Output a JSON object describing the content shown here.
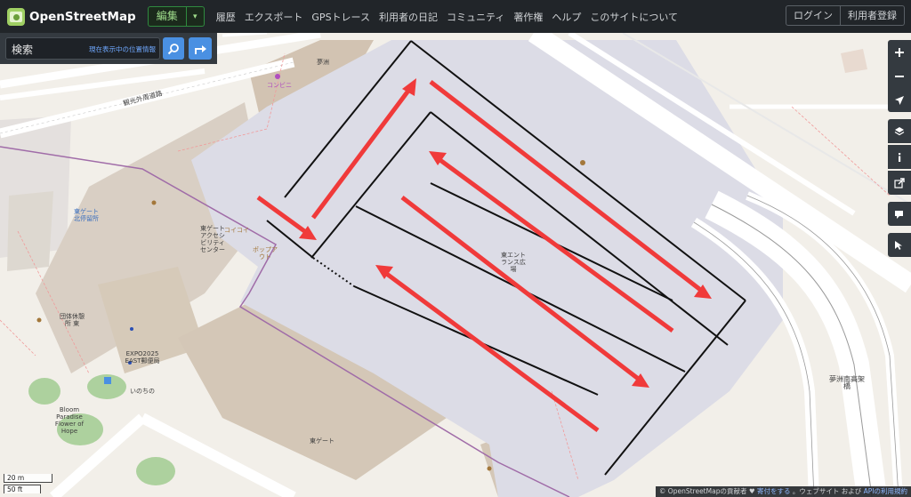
{
  "header": {
    "site_name": "OpenStreetMap",
    "edit_label": "編集",
    "nav": [
      "履歴",
      "エクスポート",
      "GPSトレース",
      "利用者の日記",
      "コミュニティ",
      "著作権",
      "ヘルプ",
      "このサイトについて"
    ],
    "login": "ログイン",
    "signup": "利用者登録"
  },
  "search": {
    "placeholder": "検索",
    "where_label": "現在表示中の位置情報"
  },
  "map_labels": {
    "road": "観光外周道路",
    "plaza": "東エントランス広場",
    "gate_station": "東ゲート北停留所",
    "info_center": "東ゲートアクセシビリティセンター",
    "coicoi": "コイコイ",
    "post": "ポップアウト",
    "rest": "団体休憩所 東",
    "expo_post": "EXPO2025 EAST郵便局",
    "inochi": "いのちの",
    "bloom": "Bloom Paradise Flower of Hope",
    "east_gate": "東ゲート",
    "bridge": "夢洲南高架橋",
    "top": "夢洲",
    "top2": "コンビニ"
  },
  "scale": {
    "metric": "20 m",
    "imperial": "50 ft"
  },
  "attribution": {
    "text1": "© OpenStreetMapの貢献者 ♥",
    "link1": "寄付をする",
    "text2": "。ウェブサイト および",
    "link2": "APIの利用規約"
  },
  "controls": [
    "zoom-in",
    "zoom-out",
    "locate",
    "layers",
    "info",
    "share",
    "note",
    "query"
  ],
  "colors": {
    "arrow": "#f03a3a",
    "plaza": "#dcdce6",
    "building": "#d9cfc4",
    "header": "#212529"
  }
}
